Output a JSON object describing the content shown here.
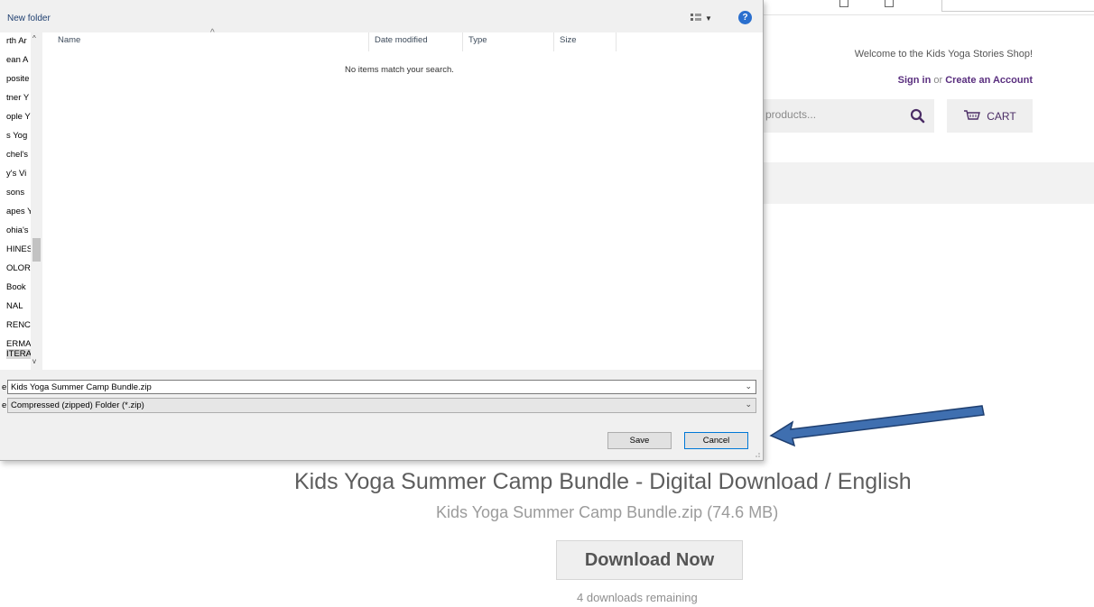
{
  "dialog": {
    "new_folder": "New folder",
    "help": "?",
    "nav_items": [
      "rth Ar",
      "ean A",
      "posite",
      "tner Y",
      "ople Y",
      "s Yog",
      "chel's",
      "y's Vi",
      "sons",
      "apes Y",
      "ohia's",
      "HINES",
      "OLOR",
      "Book",
      "NAL",
      "RENC",
      "ERMA",
      "ITERA"
    ],
    "columns": [
      "Name",
      "Date modified",
      "Type",
      "Size"
    ],
    "empty_message": "No items match your search.",
    "file_name_label": "e:",
    "file_name_value": "Kids Yoga Summer Camp Bundle.zip",
    "save_type_label": "e:",
    "save_type_value": "Compressed (zipped) Folder (*.zip)",
    "save_label": "Save",
    "cancel_label": "Cancel"
  },
  "header": {
    "welcome": "Welcome to the Kids Yoga Stories Shop!",
    "sign_in": "Sign in",
    "or": "or",
    "create_account": "Create an Account",
    "search_placeholder": "products...",
    "cart": "CART"
  },
  "product": {
    "title": "Kids Yoga Summer Camp Bundle - Digital Download / English",
    "file": "Kids Yoga Summer Camp Bundle.zip (74.6 MB)",
    "download_label": "Download Now",
    "remaining": "4 downloads remaining"
  },
  "colors": {
    "accent_purple": "#5a2f7f",
    "arrow_blue": "#3f6fb0",
    "help_blue": "#2a6fce"
  }
}
